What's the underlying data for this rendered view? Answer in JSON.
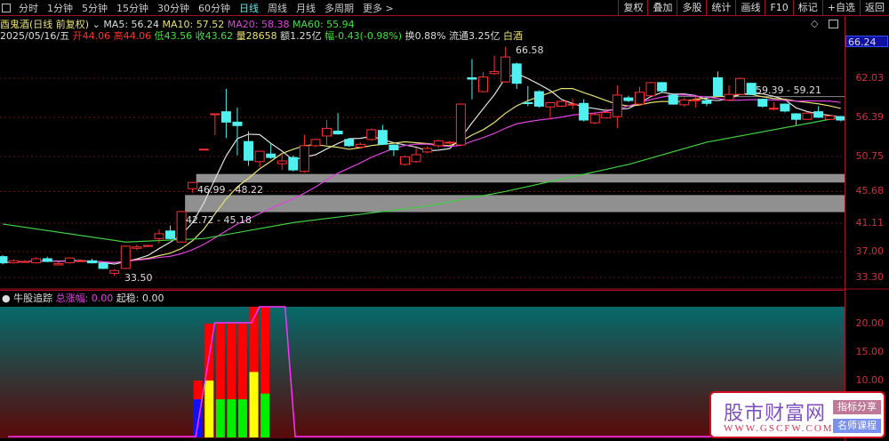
{
  "toolbar": {
    "periods": [
      "分时",
      "1分钟",
      "5分钟",
      "15分钟",
      "30分钟",
      "60分钟",
      "日线",
      "周线",
      "月线",
      "多周期",
      "更多 >"
    ],
    "active": "日线",
    "right_buttons": [
      "复权",
      "叠加",
      "多股",
      "统计",
      "画线",
      "F10",
      "标记",
      "+自选",
      "返回"
    ]
  },
  "header": {
    "title": "酉鬼酒(日线 前复权)",
    "ma5": "MA5: 56.24",
    "ma10": "MA10: 57.52",
    "ma20": "MA20: 58.38",
    "ma60": "MA60: 55.94"
  },
  "quote": {
    "date": "2025/05/16/五",
    "open": "开44.06",
    "high": "高44.06",
    "low": "低43.56",
    "close": "收43.62",
    "volume": "量28658",
    "amount": "额1.25亿",
    "change": "幅-0.43(-0.98%)",
    "turnover": "换0.88%",
    "float": "流通3.25亿",
    "sector": "白酒"
  },
  "axis": {
    "current": "66.24",
    "ticks": [
      "62.03",
      "56.39",
      "50.75",
      "45.68",
      "41.11",
      "37.00",
      "33.30"
    ],
    "indicator_ticks": [
      "20.00",
      "15.00",
      "10.00"
    ]
  },
  "annotations": {
    "high": "66.58",
    "low": "33.50",
    "zone1": "46.99 - 48.22",
    "zone2": "42.72 - 45.18",
    "line": "59.39 - 59.21"
  },
  "indicator": {
    "name": "牛股追踪",
    "total": "总涨幅: 0.00",
    "stable": "起稳: 0.00"
  },
  "colors": {
    "up": "#ff3030",
    "down": "#50f0f0",
    "ma5": "#e0e0e0",
    "ma10": "#e8e070",
    "ma20": "#e040e0",
    "ma60": "#40d040"
  },
  "chart_data": {
    "type": "candlestick",
    "price_range": [
      33.3,
      62.03
    ],
    "candles": [
      [
        36.3,
        35.4,
        36.5,
        35.2
      ],
      [
        35.4,
        35.7,
        35.9,
        35.3
      ],
      [
        35.6,
        35.6,
        35.8,
        35.4
      ],
      [
        35.4,
        36.0,
        36.2,
        35.3
      ],
      [
        36.0,
        35.6,
        36.3,
        35.5
      ],
      [
        35.1,
        35.3,
        35.5,
        35.0
      ],
      [
        35.4,
        36.1,
        36.2,
        35.3
      ],
      [
        35.7,
        35.7,
        35.9,
        35.5
      ],
      [
        35.7,
        35.4,
        36.0,
        35.3
      ],
      [
        35.3,
        34.6,
        35.5,
        34.5
      ],
      [
        33.9,
        34.3,
        34.5,
        33.5
      ],
      [
        34.6,
        37.8,
        37.9,
        34.5
      ],
      [
        37.5,
        37.7,
        38.0,
        37.2
      ],
      [
        37.8,
        37.9,
        38.0,
        37.7
      ],
      [
        38.9,
        39.6,
        40.2,
        38.2
      ],
      [
        40.0,
        38.9,
        40.8,
        38.8
      ],
      [
        38.4,
        42.8,
        42.9,
        38.3
      ],
      [
        46.1,
        47.0,
        47.1,
        45.5
      ],
      [
        51.8,
        51.8,
        51.8,
        51.8
      ],
      [
        56.9,
        56.9,
        56.9,
        53.8
      ],
      [
        57.2,
        55.7,
        60.5,
        53.4
      ],
      [
        55.7,
        55.2,
        57.8,
        50.9
      ],
      [
        52.9,
        50.2,
        54.4,
        49.4
      ],
      [
        50.0,
        51.5,
        51.6,
        49.2
      ],
      [
        51.1,
        50.6,
        52.6,
        50.4
      ],
      [
        49.7,
        50.1,
        51.2,
        48.8
      ],
      [
        50.6,
        48.8,
        50.9,
        48.6
      ],
      [
        48.6,
        52.3,
        53.9,
        48.4
      ],
      [
        52.3,
        53.2,
        53.3,
        52.1
      ],
      [
        53.7,
        54.8,
        56.0,
        52.4
      ],
      [
        54.4,
        54.0,
        57.0,
        53.9
      ],
      [
        53.2,
        52.3,
        53.4,
        52.1
      ],
      [
        52.1,
        52.5,
        52.8,
        51.9
      ],
      [
        53.2,
        54.6,
        54.8,
        53.0
      ],
      [
        54.5,
        52.5,
        55.3,
        52.4
      ],
      [
        52.4,
        51.7,
        52.5,
        50.8
      ],
      [
        49.6,
        50.7,
        50.9,
        49.4
      ],
      [
        50.0,
        51.0,
        52.0,
        49.8
      ],
      [
        51.4,
        51.9,
        52.2,
        51.2
      ],
      [
        52.3,
        53.0,
        53.2,
        52.0
      ],
      [
        52.7,
        52.8,
        53.0,
        52.5
      ],
      [
        52.4,
        58.3,
        58.4,
        52.3
      ],
      [
        62.1,
        61.9,
        64.8,
        59.0
      ],
      [
        60.1,
        62.2,
        62.9,
        60.0
      ],
      [
        62.7,
        63.0,
        65.3,
        62.5
      ],
      [
        61.5,
        65.1,
        66.58,
        61.4
      ],
      [
        64.1,
        61.3,
        64.3,
        60.5
      ],
      [
        58.5,
        58.4,
        60.9,
        58.0
      ],
      [
        60.1,
        58.0,
        60.3,
        57.8
      ],
      [
        57.9,
        58.5,
        58.6,
        56.1
      ],
      [
        58.0,
        58.7,
        58.8,
        57.9
      ],
      [
        58.3,
        58.3,
        59.1,
        57.6
      ],
      [
        58.4,
        56.0,
        59.0,
        55.8
      ],
      [
        55.6,
        56.8,
        57.2,
        55.4
      ],
      [
        56.3,
        57.1,
        57.7,
        56.2
      ],
      [
        56.5,
        59.6,
        61.0,
        54.8
      ],
      [
        59.2,
        58.8,
        59.5,
        58.6
      ],
      [
        58.3,
        60.0,
        60.8,
        58.2
      ],
      [
        59.5,
        61.4,
        61.5,
        59.4
      ],
      [
        61.4,
        60.2,
        61.5,
        60.0
      ],
      [
        59.6,
        58.3,
        59.7,
        58.2
      ],
      [
        58.2,
        58.9,
        59.2,
        57.9
      ],
      [
        58.9,
        58.9,
        59.4,
        57.8
      ],
      [
        58.8,
        58.4,
        59.3,
        58.0
      ],
      [
        62.1,
        59.5,
        63.0,
        59.3
      ],
      [
        58.9,
        59.7,
        61.0,
        58.8
      ],
      [
        59.7,
        62.0,
        62.1,
        59.6
      ],
      [
        61.3,
        59.7,
        61.4,
        59.6
      ],
      [
        59.0,
        58.0,
        59.1,
        57.8
      ],
      [
        57.6,
        57.7,
        58.6,
        57.4
      ],
      [
        58.3,
        57.3,
        58.4,
        57.1
      ],
      [
        56.9,
        56.1,
        57.0,
        55.3
      ],
      [
        56.1,
        57.0,
        57.1,
        56.0
      ],
      [
        57.2,
        56.4,
        58.0,
        56.3
      ],
      [
        56.1,
        56.6,
        56.7,
        56.0
      ],
      [
        56.5,
        56.0,
        56.6,
        55.8
      ]
    ],
    "ma60_points": [
      [
        0,
        41.0
      ],
      [
        11,
        38.4
      ],
      [
        18,
        38.9
      ],
      [
        26,
        41.2
      ],
      [
        38,
        43.6
      ],
      [
        45,
        45.7
      ],
      [
        56,
        49.6
      ],
      [
        63,
        52.8
      ],
      [
        75,
        56.4
      ]
    ],
    "zones": [
      [
        46.99,
        48.22,
        17
      ],
      [
        42.72,
        45.18,
        16
      ]
    ],
    "hline": [
      59.3,
      66
    ],
    "indicator": {
      "range": [
        0,
        23
      ],
      "bars": [
        {
          "i": 17,
          "segs": [
            [
              "#1010ff",
              6.7
            ],
            [
              "#ff0000",
              10
            ]
          ]
        },
        {
          "i": 18,
          "segs": [
            [
              "#ffff00",
              10
            ],
            [
              "#ff0000",
              20
            ]
          ]
        },
        {
          "i": 19,
          "segs": [
            [
              "#00ee00",
              6.7
            ],
            [
              "#ff0000",
              20
            ]
          ]
        },
        {
          "i": 20,
          "segs": [
            [
              "#00ee00",
              6.7
            ],
            [
              "#ff0000",
              20
            ]
          ]
        },
        {
          "i": 21,
          "segs": [
            [
              "#00ee00",
              6.7
            ],
            [
              "#ff0000",
              20
            ]
          ]
        },
        {
          "i": 22,
          "segs": [
            [
              "#ffff00",
              11.5
            ],
            [
              "#ff0000",
              23
            ]
          ]
        },
        {
          "i": 23,
          "segs": [
            [
              "#00ee00",
              7.7
            ],
            [
              "#ff0000",
              23
            ]
          ]
        }
      ],
      "line": [
        [
          0,
          0
        ],
        [
          16.8,
          0
        ],
        [
          18.5,
          20
        ],
        [
          21.8,
          20
        ],
        [
          22.5,
          23
        ],
        [
          24.8,
          23
        ],
        [
          25.7,
          0
        ],
        [
          75,
          0
        ]
      ]
    }
  },
  "watermark": {
    "name": "股市财富网",
    "url": "WWW.GSCFW.COM",
    "tag1": "指标分享",
    "tag2": "名师课程"
  }
}
